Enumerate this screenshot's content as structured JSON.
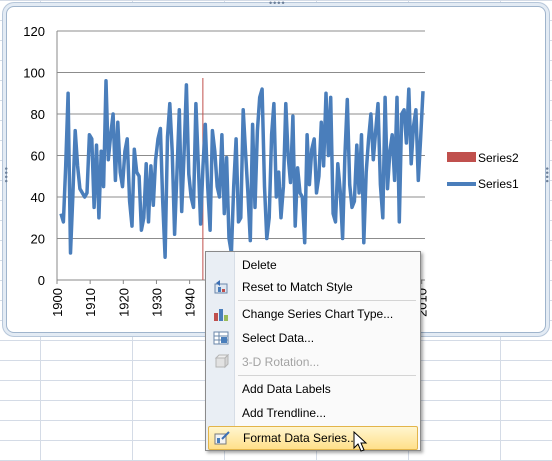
{
  "chart_data": {
    "type": "line",
    "y_ticks": [
      "0",
      "20",
      "40",
      "60",
      "80",
      "100",
      "120"
    ],
    "x_ticks": [
      "1900",
      "1910",
      "1920",
      "1930",
      "1940",
      "1950",
      "1960",
      "1970",
      "1980",
      "1990",
      "2000",
      "2010"
    ],
    "ylim": [
      0,
      120
    ],
    "xlim": [
      1900,
      2011
    ],
    "grid": "horizontal",
    "legend_position": "right",
    "series": [
      {
        "name": "Series1",
        "color": "#4a7ebb",
        "values": [
          32,
          28,
          55,
          90,
          13,
          40,
          72,
          55,
          44,
          42,
          40,
          42,
          70,
          68,
          35,
          65,
          30,
          62,
          45,
          96,
          58,
          70,
          80,
          48,
          76,
          52,
          45,
          62,
          68,
          38,
          26,
          63,
          52,
          50,
          24,
          30,
          56,
          28,
          55,
          36,
          58,
          68,
          73,
          38,
          11,
          69,
          85,
          62,
          22,
          51,
          82,
          33,
          60,
          94,
          51,
          40,
          35,
          85,
          57,
          27,
          55,
          75,
          45,
          24,
          72,
          62,
          45,
          40,
          70,
          32,
          59,
          20,
          13,
          45,
          68,
          28,
          30,
          82,
          62,
          42,
          19,
          75,
          35,
          72,
          88,
          92,
          45,
          20,
          30,
          70,
          85,
          40,
          52,
          30,
          45,
          85,
          60,
          47,
          79,
          26,
          54,
          42,
          40,
          18,
          70,
          46,
          63,
          68,
          42,
          50,
          76,
          55,
          90,
          60,
          88,
          32,
          28,
          56,
          43,
          20,
          60,
          87,
          46,
          35,
          38,
          65,
          42,
          70,
          18,
          52,
          68,
          80,
          58,
          72,
          85,
          46,
          30,
          88,
          44,
          62,
          70,
          48,
          88,
          28,
          80,
          82,
          66,
          92,
          56,
          74,
          82,
          48,
          68,
          91
        ]
      }
    ],
    "legend": [
      "Series2",
      "Series1"
    ],
    "marker_year": 1944
  },
  "legend_colors": {
    "Series2": "#c0504d",
    "Series1": "#4a7ebb"
  },
  "context_menu": {
    "items": [
      {
        "label": "Delete",
        "icon": "",
        "disabled": false,
        "highlighted": false
      },
      {
        "label": "Reset to Match Style",
        "icon": "reset-style-icon",
        "disabled": false,
        "highlighted": false
      },
      {
        "label": "Change Series Chart Type...",
        "icon": "chart-type-icon",
        "disabled": false,
        "highlighted": false
      },
      {
        "label": "Select Data...",
        "icon": "select-data-icon",
        "disabled": false,
        "highlighted": false
      },
      {
        "label": "3-D Rotation...",
        "icon": "3d-rotation-icon",
        "disabled": true,
        "highlighted": false
      },
      {
        "label": "Add Data Labels",
        "icon": "",
        "disabled": false,
        "highlighted": false
      },
      {
        "label": "Add Trendline...",
        "icon": "",
        "disabled": false,
        "highlighted": false
      },
      {
        "label": "Format Data Series...",
        "icon": "format-series-icon",
        "disabled": false,
        "highlighted": true
      }
    ]
  }
}
